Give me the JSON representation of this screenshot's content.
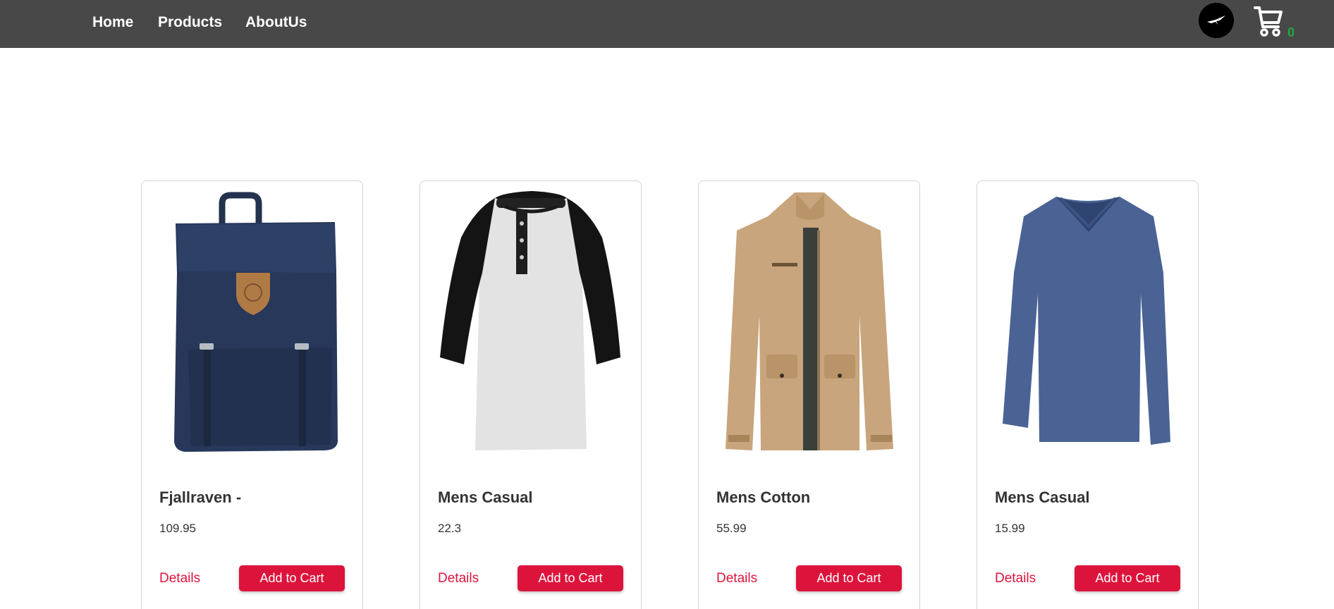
{
  "nav": {
    "links": [
      "Home",
      "Products",
      "AboutUs"
    ],
    "cart_count": "0",
    "avatar_icon": "bird-logo-icon",
    "cart_icon": "shopping-cart-icon"
  },
  "colors": {
    "navbar": "#484848",
    "accent": "#dc143c",
    "cart_count": "#28a745"
  },
  "products": [
    {
      "title": "Fjallraven -",
      "price": "109.95",
      "details_label": "Details",
      "cart_label": "Add to Cart",
      "image": "backpack-image"
    },
    {
      "title": "Mens Casual",
      "price": "22.3",
      "details_label": "Details",
      "cart_label": "Add to Cart",
      "image": "raglan-shirt-image"
    },
    {
      "title": "Mens Cotton",
      "price": "55.99",
      "details_label": "Details",
      "cart_label": "Add to Cart",
      "image": "jacket-image"
    },
    {
      "title": "Mens Casual",
      "price": "15.99",
      "details_label": "Details",
      "cart_label": "Add to Cart",
      "image": "long-sleeve-shirt-image"
    }
  ]
}
